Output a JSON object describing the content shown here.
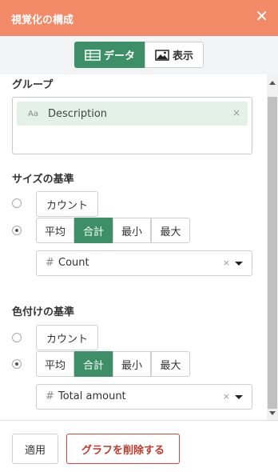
{
  "header": {
    "title": "視覚化の構成",
    "close_icon": "close-icon",
    "bg_color": "#f28a68"
  },
  "tabs": [
    {
      "label": "データ",
      "icon": "table-icon",
      "active": true
    },
    {
      "label": "表示",
      "icon": "image-icon",
      "active": false
    }
  ],
  "group": {
    "label": "グループ",
    "chip": {
      "type_icon": "Aa",
      "text": "Description",
      "remove_icon": "×"
    }
  },
  "size_basis": {
    "label": "サイズの基準",
    "count_label": "カウント",
    "aggregations": [
      "平均",
      "合計",
      "最小",
      "最大"
    ],
    "selected_aggregation": "合計",
    "selected_option": "aggregation",
    "field": {
      "type_icon": "#",
      "value": "Count",
      "clear": "×"
    }
  },
  "color_basis": {
    "label": "色付けの基準",
    "count_label": "カウント",
    "aggregations": [
      "平均",
      "合計",
      "最小",
      "最大"
    ],
    "selected_aggregation": "合計",
    "selected_option": "aggregation",
    "field": {
      "type_icon": "#",
      "value": "Total amount",
      "clear": "×"
    }
  },
  "footer": {
    "apply_label": "適用",
    "delete_label": "グラフを削除する"
  },
  "colors": {
    "accent": "#3d8f67",
    "danger": "#c0392b"
  }
}
